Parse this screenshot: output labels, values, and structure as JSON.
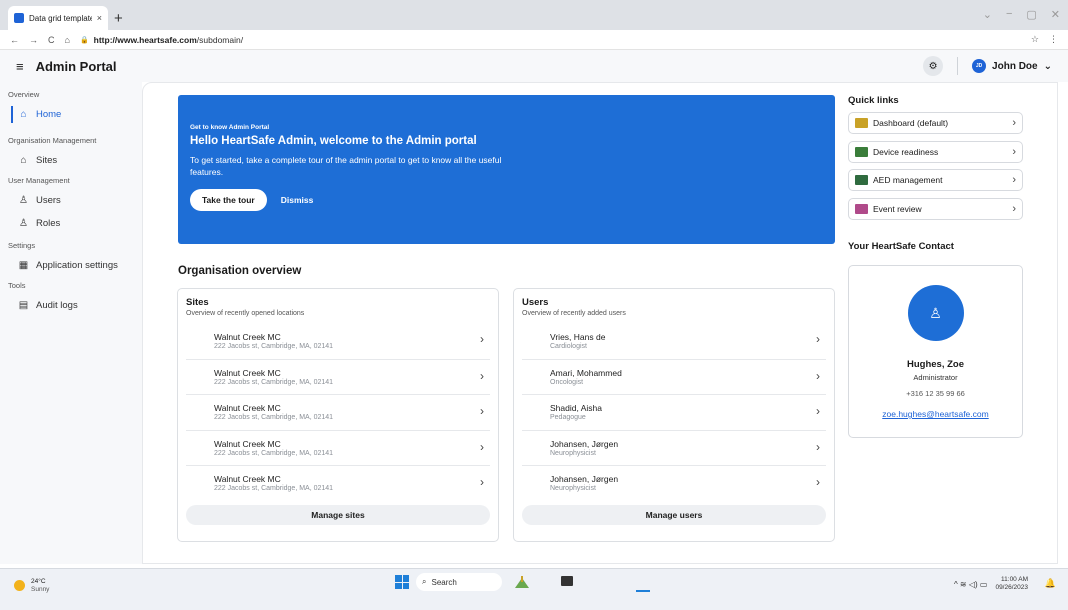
{
  "browser": {
    "tab_title": "Data grid template",
    "tab_close": "×",
    "new_tab": "+",
    "url_host": "http://www.heartsafe.com",
    "url_path": "/subdomain/",
    "nav_back": "←",
    "nav_forward": "→",
    "nav_reload": "C",
    "nav_home": "⌂",
    "lock": "🔒",
    "star": "☆",
    "menu": "⋮",
    "win_controls": [
      "⌄",
      "−",
      "▢",
      "✕"
    ]
  },
  "header": {
    "menu_icon": "≡",
    "title": "Admin Portal",
    "bell": "⚙",
    "user_initials": "JD",
    "user_name": "John Doe",
    "user_chevron": "⌄"
  },
  "sidebar": {
    "groups": {
      "overview": "Overview",
      "org_mgmt": "Organisation Management",
      "user_mgmt": "User Management",
      "settings": "Settings",
      "tools": "Tools"
    },
    "items": {
      "home": "Home",
      "sites": "Sites",
      "users": "Users",
      "roles": "Roles",
      "app_settings": "Application settings",
      "audit_logs": "Audit logs"
    }
  },
  "banner": {
    "kicker": "Get to know Admin Portal",
    "title": "Hello HeartSafe Admin, welcome to the Admin portal",
    "description": "To get started, take a complete tour of the admin portal to get to know all the useful features.",
    "tour_button": "Take the tour",
    "dismiss": "Dismiss"
  },
  "overview_title": "Organisation overview",
  "sites_card": {
    "title": "Sites",
    "subtitle": "Overview of recently opened locations",
    "rows": [
      {
        "name": "Walnut Creek MC",
        "address": "222 Jacobs st, Cambridge, MA, 02141"
      },
      {
        "name": "Walnut Creek MC",
        "address": "222 Jacobs st, Cambridge, MA, 02141"
      },
      {
        "name": "Walnut Creek MC",
        "address": "222 Jacobs st, Cambridge, MA, 02141"
      },
      {
        "name": "Walnut Creek MC",
        "address": "222 Jacobs st, Cambridge, MA, 02141"
      },
      {
        "name": "Walnut Creek MC",
        "address": "222 Jacobs st, Cambridge, MA, 02141"
      }
    ],
    "button": "Manage sites"
  },
  "users_card": {
    "title": "Users",
    "subtitle": "Overview of recently added users",
    "rows": [
      {
        "name": "Vries, Hans de",
        "role": "Cardiologist"
      },
      {
        "name": "Amari, Mohammed",
        "role": "Oncologist"
      },
      {
        "name": "Shadid, Aisha",
        "role": "Pedagogue"
      },
      {
        "name": "Johansen, Jørgen",
        "role": "Neurophysicist"
      },
      {
        "name": "Johansen, Jørgen",
        "role": "Neurophysicist"
      }
    ],
    "button": "Manage users"
  },
  "quick_links": {
    "title": "Quick links",
    "items": [
      {
        "label": "Dashboard (default)",
        "color": "#c9a227"
      },
      {
        "label": "Device readiness",
        "color": "#3a7d3a"
      },
      {
        "label": "AED management",
        "color": "#2f6b3f"
      },
      {
        "label": "Event review",
        "color": "#b04a8a"
      }
    ]
  },
  "contact": {
    "title": "Your HeartSafe Contact",
    "name": "Hughes, Zoe",
    "role": "Administrator",
    "phone": "+316 12 35 99 66",
    "email": "zoe.hughes@heartsafe.com"
  },
  "taskbar": {
    "temp": "24°C",
    "weather": "Sunny",
    "search": "Search",
    "time": "11:00 AM",
    "date": "09/26/2023",
    "tray": "^  ≋  ◁)  ▭"
  },
  "glyph": {
    "chevron": "›",
    "person": "♙"
  },
  "colors": {
    "accent": "#1e6ed6"
  }
}
